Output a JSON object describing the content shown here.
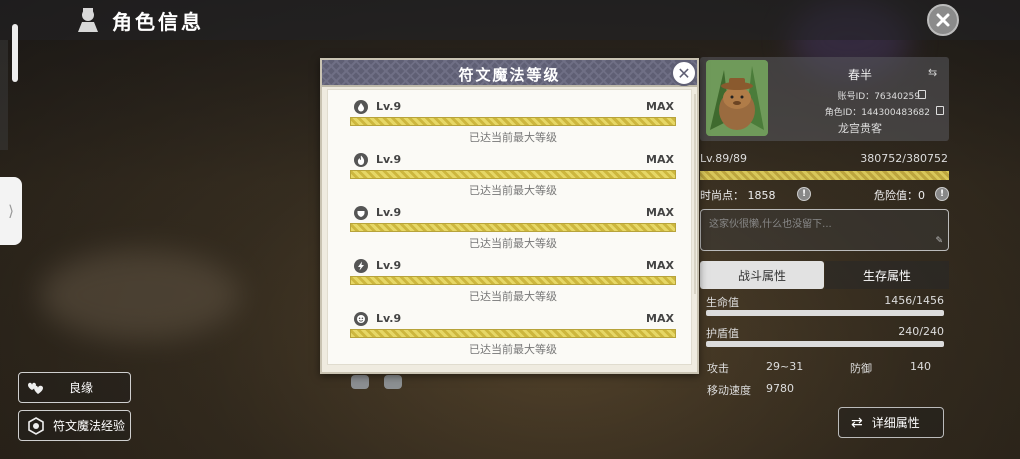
{
  "header": {
    "title": "角色信息"
  },
  "left_buttons": [
    {
      "label": "良缘",
      "icon": "hearts-icon"
    },
    {
      "label": "符文魔法经验",
      "icon": "rune-icon"
    }
  ],
  "side_tab": {
    "glyph": "⟩"
  },
  "modal": {
    "title": "符文魔法等级",
    "close_glyph": "✕",
    "runes": [
      {
        "icon": "water-drop-icon",
        "level": "Lv.9",
        "max": "MAX",
        "note": "已达当前最大等级",
        "progress": 1.0
      },
      {
        "icon": "flame-icon",
        "level": "Lv.9",
        "max": "MAX",
        "note": "已达当前最大等级",
        "progress": 1.0
      },
      {
        "icon": "shield-icon",
        "level": "Lv.9",
        "max": "MAX",
        "note": "已达当前最大等级",
        "progress": 1.0
      },
      {
        "icon": "lightning-icon",
        "level": "Lv.9",
        "max": "MAX",
        "note": "已达当前最大等级",
        "progress": 1.0
      },
      {
        "icon": "face-icon",
        "level": "Lv.9",
        "max": "MAX",
        "note": "已达当前最大等级",
        "progress": 1.0
      }
    ]
  },
  "profile": {
    "name": "春半",
    "account_label": "账号ID：",
    "account_id": "76340259",
    "role_label": "角色ID：",
    "role_id": "144300483682",
    "rank_title": "龙宫贵客",
    "level": "Lv.89/89",
    "exp": "380752/380752",
    "exp_progress": 1.0,
    "fashion_label": "时尚点：",
    "fashion_value": "1858",
    "danger_label": "危险值：",
    "danger_value": "0",
    "signature_placeholder": "这家伙很懒,什么也没留下...",
    "pen_glyph": "✎"
  },
  "tabs": {
    "combat": "战斗属性",
    "survival": "生存属性"
  },
  "attributes": {
    "hp_label": "生命值",
    "hp_value": "1456/1456",
    "hp_progress": 1.0,
    "shield_label": "护盾值",
    "shield_value": "240/240",
    "shield_progress": 1.0,
    "attack_label": "攻击",
    "attack_value": "29~31",
    "defense_label": "防御",
    "defense_value": "140",
    "speed_label": "移动速度",
    "speed_value": "9780"
  },
  "detail_button": {
    "label": "详细属性",
    "glyph": "⇄"
  },
  "colors": {
    "modal_header": "#5f5f74",
    "progress_bar": "#d7c54a",
    "modal_bg": "#efebe0"
  }
}
